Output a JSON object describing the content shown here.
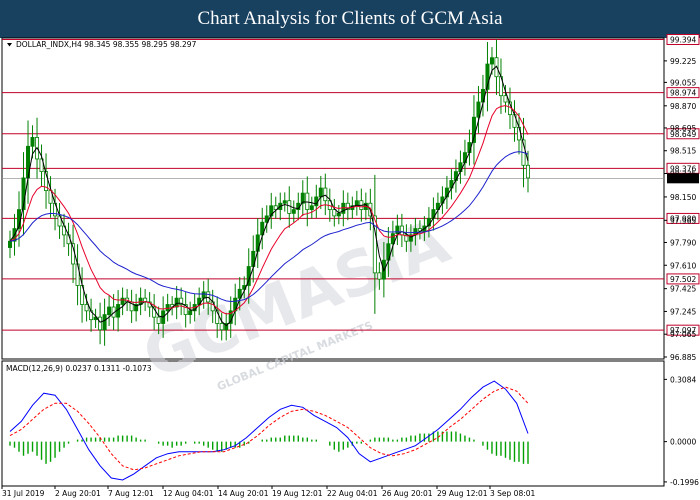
{
  "banner": {
    "title": "Chart Analysis for Clients of GCM Asia"
  },
  "header": {
    "symbol_text": "DOLLAR_INDX,H4  98.345 98.355 98.295 98.297"
  },
  "macd_header": {
    "text": "MACD(12,26,9) 0.0237 0.1311 -0.1073"
  },
  "watermark": {
    "text": "GCMASIA",
    "sub": "GLOBAL CAPITAL MARKETS"
  },
  "colors": {
    "candle": "#008000",
    "ma_fast": "#000000",
    "ma_mid": "#e8002a",
    "ma_slow": "#1e22cc",
    "level": "#c0002a",
    "macd_line": "#0000ff",
    "signal": "#ff0000",
    "hist": "#00a000",
    "bg": "#ffffff",
    "banner": "#18405f"
  },
  "chart_data": {
    "type": "candlestick",
    "price_axis_ticks": [
      99.225,
      99.055,
      98.87,
      98.695,
      98.515,
      98.335,
      98.15,
      97.965,
      97.79,
      97.61,
      97.425,
      97.245,
      97.065,
      96.885
    ],
    "ylim": [
      96.885,
      99.39
    ],
    "levels": [
      {
        "label": "99.394",
        "value": 99.394
      },
      {
        "label": "98.974",
        "value": 98.974
      },
      {
        "label": "98.649",
        "value": 98.649
      },
      {
        "label": "98.376",
        "value": 98.376
      },
      {
        "label": "97.980",
        "value": 97.98
      },
      {
        "label": "97.502",
        "value": 97.502
      },
      {
        "label": "97.097",
        "value": 97.097
      }
    ],
    "current_price": {
      "label": "98.297",
      "value": 98.297
    },
    "x_labels": [
      "31 Jul 2019",
      "2 Aug 20:01",
      "7 Aug 12:01",
      "12 Aug 04:01",
      "14 Aug 20:01",
      "19 Aug 12:01",
      "22 Aug 04:01",
      "26 Aug 20:01",
      "29 Aug 12:01",
      "3 Sep 08:01"
    ],
    "close": [
      97.8,
      97.9,
      98.05,
      98.3,
      98.55,
      98.62,
      98.45,
      98.35,
      98.2,
      98.1,
      98.0,
      97.92,
      97.85,
      97.78,
      97.62,
      97.45,
      97.3,
      97.25,
      97.18,
      97.2,
      97.1,
      97.22,
      97.28,
      97.2,
      97.3,
      97.35,
      97.32,
      97.25,
      97.3,
      97.35,
      97.32,
      97.28,
      97.2,
      97.15,
      97.25,
      97.3,
      97.28,
      97.35,
      97.3,
      97.22,
      97.25,
      97.3,
      97.35,
      97.4,
      97.32,
      97.25,
      97.15,
      97.1,
      97.15,
      97.25,
      97.35,
      97.42,
      97.45,
      97.6,
      97.72,
      97.85,
      97.95,
      98.0,
      98.08,
      98.05,
      98.1,
      98.12,
      98.02,
      98.05,
      98.1,
      98.18,
      98.05,
      98.08,
      98.15,
      98.22,
      98.12,
      98.05,
      98.0,
      98.02,
      98.1,
      98.05,
      98.08,
      98.12,
      98.05,
      98.1,
      98.0,
      97.55,
      97.5,
      97.65,
      97.78,
      97.86,
      97.92,
      97.85,
      97.8,
      97.85,
      97.9,
      97.88,
      97.92,
      97.98,
      98.05,
      98.1,
      98.15,
      98.22,
      98.28,
      98.35,
      98.42,
      98.5,
      98.58,
      98.78,
      98.9,
      99.0,
      99.2,
      99.25,
      99.1,
      98.95,
      98.9,
      98.8,
      98.7,
      98.6,
      98.4,
      98.3
    ],
    "macd": {
      "yticks": [
        0.3084,
        0.0,
        -0.1996
      ],
      "ylim": [
        -0.2,
        0.33
      ],
      "line": [
        0.05,
        0.1,
        0.18,
        0.24,
        0.23,
        0.16,
        0.06,
        -0.04,
        -0.12,
        -0.18,
        -0.19,
        -0.16,
        -0.12,
        -0.08,
        -0.06,
        -0.05,
        -0.05,
        -0.05,
        -0.05,
        -0.04,
        -0.02,
        0.02,
        0.07,
        0.12,
        0.16,
        0.18,
        0.17,
        0.13,
        0.1,
        0.07,
        0.02,
        -0.06,
        -0.1,
        -0.08,
        -0.06,
        -0.04,
        -0.02,
        0.02,
        0.06,
        0.11,
        0.16,
        0.22,
        0.27,
        0.3,
        0.26,
        0.19,
        0.04
      ],
      "signal": [
        0.03,
        0.06,
        0.11,
        0.16,
        0.19,
        0.19,
        0.15,
        0.09,
        0.02,
        -0.06,
        -0.12,
        -0.14,
        -0.13,
        -0.11,
        -0.09,
        -0.07,
        -0.06,
        -0.05,
        -0.05,
        -0.05,
        -0.03,
        -0.01,
        0.03,
        0.08,
        0.12,
        0.15,
        0.16,
        0.15,
        0.13,
        0.1,
        0.07,
        0.02,
        -0.03,
        -0.06,
        -0.07,
        -0.06,
        -0.04,
        -0.01,
        0.02,
        0.07,
        0.11,
        0.16,
        0.21,
        0.25,
        0.27,
        0.25,
        0.19
      ],
      "hist": [
        -0.02,
        -0.03,
        -0.05,
        -0.07,
        -0.06,
        -0.05,
        -0.07,
        -0.09,
        -0.11,
        -0.1,
        -0.08,
        -0.05,
        -0.03,
        -0.01,
        0.0,
        0.01,
        0.01,
        0.02,
        0.02,
        0.02,
        0.02,
        0.02,
        0.02,
        0.02,
        0.03,
        0.03,
        0.03,
        0.03,
        0.02,
        0.01,
        0.01,
        0.0,
        0.0,
        -0.01,
        -0.02,
        -0.02,
        -0.03,
        -0.02,
        -0.02,
        -0.01,
        0.0,
        -0.01,
        -0.01,
        -0.02,
        -0.03,
        -0.04,
        -0.05,
        -0.05,
        -0.04,
        -0.03,
        -0.03,
        -0.03,
        -0.02,
        -0.01,
        0.0,
        0.0,
        0.01,
        0.01,
        0.02,
        0.02,
        0.02,
        0.03,
        0.03,
        0.03,
        0.03,
        0.02,
        0.02,
        0.01,
        0.01,
        0.0,
        0.0,
        -0.02,
        -0.04,
        -0.05,
        -0.04,
        -0.03,
        -0.02,
        -0.01,
        -0.01,
        0.0,
        0.01,
        0.02,
        0.02,
        0.02,
        0.02,
        0.01,
        0.01,
        0.02,
        0.02,
        0.03,
        0.03,
        0.04,
        0.04,
        0.04,
        0.05,
        0.05,
        0.05,
        0.05,
        0.05,
        0.05,
        0.04,
        0.03,
        0.02,
        0.01,
        0.0,
        -0.02,
        -0.04,
        -0.06,
        -0.07,
        -0.07,
        -0.08,
        -0.09,
        -0.1,
        -0.1,
        -0.11,
        -0.11
      ]
    }
  }
}
